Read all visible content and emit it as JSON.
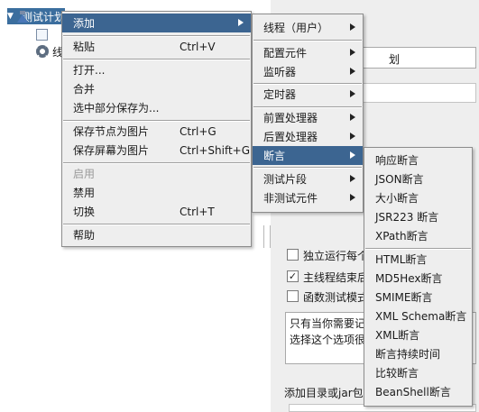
{
  "tree": {
    "root_label": "测试计划",
    "child1_label": "",
    "child2_label": "线"
  },
  "right_pane": {
    "name_value": "划",
    "checkbox1_label": "独立运行每个",
    "checkbox2_label": "主线程结束后",
    "checkbox3_label": "函数测试模式",
    "textarea_line1": "只有当你需要记",
    "textarea_line2": "选择这个选项很",
    "bottom_label": "添加目录或jar包"
  },
  "context_menu": {
    "items": [
      {
        "label": "添加",
        "accel": "",
        "submenu": true
      },
      {
        "label": "粘贴",
        "accel": "Ctrl+V"
      },
      {
        "label": "打开...",
        "accel": ""
      },
      {
        "label": "合并",
        "accel": ""
      },
      {
        "label": "选中部分保存为...",
        "accel": ""
      },
      {
        "label": "保存节点为图片",
        "accel": "Ctrl+G"
      },
      {
        "label": "保存屏幕为图片",
        "accel": "Ctrl+Shift+G"
      },
      {
        "label": "启用",
        "accel": ""
      },
      {
        "label": "禁用",
        "accel": ""
      },
      {
        "label": "切换",
        "accel": "Ctrl+T"
      },
      {
        "label": "帮助",
        "accel": ""
      }
    ]
  },
  "add_menu": {
    "items": [
      {
        "label": "线程（用户）"
      },
      {
        "label": "配置元件"
      },
      {
        "label": "监听器"
      },
      {
        "label": "定时器"
      },
      {
        "label": "前置处理器"
      },
      {
        "label": "后置处理器"
      },
      {
        "label": "断言"
      },
      {
        "label": "测试片段"
      },
      {
        "label": "非测试元件"
      }
    ]
  },
  "assertion_menu": {
    "items": [
      {
        "label": "响应断言"
      },
      {
        "label": "JSON断言"
      },
      {
        "label": "大小断言"
      },
      {
        "label": "JSR223 断言"
      },
      {
        "label": "XPath断言"
      },
      {
        "label": "HTML断言"
      },
      {
        "label": "MD5Hex断言"
      },
      {
        "label": "SMIME断言"
      },
      {
        "label": "XML Schema断言"
      },
      {
        "label": "XML断言"
      },
      {
        "label": "断言持续时间"
      },
      {
        "label": "比较断言"
      },
      {
        "label": "BeanShell断言"
      }
    ]
  },
  "colors": {
    "highlight": "#3c6591",
    "menu_bg": "#eeeeee",
    "selected_tree": "#3b6e9e"
  }
}
